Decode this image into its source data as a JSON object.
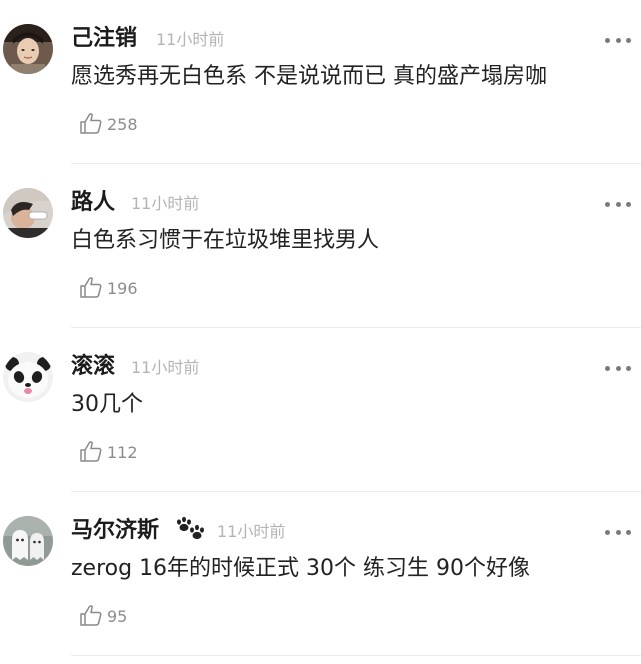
{
  "colors": {
    "timestamp": "#b4b4b4",
    "like_count": "#8c8c8c",
    "divider": "#ececec"
  },
  "comments": [
    {
      "username": "己注销",
      "timestamp": "11小时前",
      "text": "愿选秀再无白色系 不是说说而已 真的盛产塌房咖",
      "likes": "258",
      "avatar_icon": "avatar-woman-icon"
    },
    {
      "username": "路人",
      "timestamp": "11小时前",
      "text": "白色系习惯于在垃圾堆里找男人",
      "likes": "196",
      "avatar_icon": "avatar-man-drinking-icon"
    },
    {
      "username": "滚滚",
      "timestamp": "11小时前",
      "text": "30几个",
      "likes": "112",
      "avatar_icon": "avatar-panda-icon"
    },
    {
      "username": "马尔济斯",
      "timestamp": "11小时前",
      "text": "zerog 16年的时候正式 30个 练习生 90个好像",
      "likes": "95",
      "avatar_icon": "avatar-ghosts-icon",
      "name_icon": "paw-icon"
    }
  ]
}
